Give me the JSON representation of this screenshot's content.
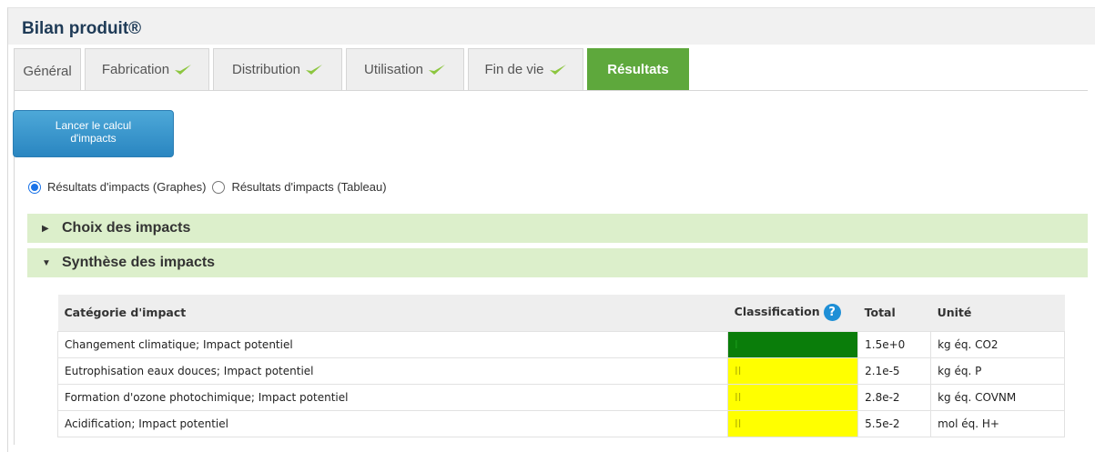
{
  "page": {
    "title": "Bilan produit®"
  },
  "tabs": [
    {
      "label": "Général",
      "checked": false,
      "active": false
    },
    {
      "label": "Fabrication",
      "checked": true,
      "active": false
    },
    {
      "label": "Distribution",
      "checked": true,
      "active": false
    },
    {
      "label": "Utilisation",
      "checked": true,
      "active": false
    },
    {
      "label": "Fin de vie",
      "checked": true,
      "active": false
    },
    {
      "label": "Résultats",
      "checked": false,
      "active": true
    }
  ],
  "actions": {
    "calc_line1": "Lancer le calcul",
    "calc_line2": "d'impacts"
  },
  "view_options": {
    "graph_label": "Résultats d'impacts (Graphes)",
    "table_label": "Résultats d'impacts (Tableau)",
    "selected": "graph"
  },
  "sections": {
    "choice": "Choix des impacts",
    "synthesis": "Synthèse des impacts"
  },
  "table": {
    "headers": {
      "category": "Catégorie d'impact",
      "classification": "Classification",
      "total": "Total",
      "unit": "Unité"
    },
    "rows": [
      {
        "category": "Changement climatique; Impact potentiel",
        "classification": "I",
        "class_color": "#0a7d0a",
        "total": "1.5e+0",
        "unit": "kg éq. CO2"
      },
      {
        "category": "Eutrophisation eaux douces; Impact potentiel",
        "classification": "II",
        "class_color": "#ffff00",
        "total": "2.1e-5",
        "unit": "kg éq. P"
      },
      {
        "category": "Formation d'ozone photochimique; Impact potentiel",
        "classification": "II",
        "class_color": "#ffff00",
        "total": "2.8e-2",
        "unit": "kg éq. COVNM"
      },
      {
        "category": "Acidification; Impact potentiel",
        "classification": "II",
        "class_color": "#ffff00",
        "total": "5.5e-2",
        "unit": "mol éq. H+"
      }
    ]
  },
  "colors": {
    "accent_green": "#5ea83c",
    "section_green": "#dcefcb",
    "button_blue": "#2a86c1"
  }
}
